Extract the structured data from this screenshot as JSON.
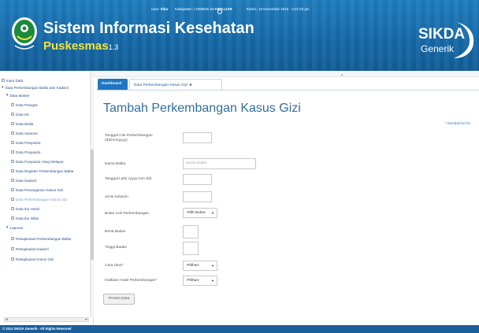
{
  "header": {
    "status": {
      "user_label": "User:",
      "user_name": "Ildar",
      "kabupaten": "Kabupaten: LOMBOK BARAT",
      "logout": "KELUAR",
      "datetime": "Kamis, 19 November 2015 - 2:21:53 pm"
    },
    "title_line1": "Sistem Informasi Kesehatan",
    "title_line2": "Puskesmas",
    "version": "1.3",
    "brand_line1": "SIKDA",
    "brand_line2": "Generik"
  },
  "sidebar": {
    "items": [
      {
        "label": "Input Data",
        "icon": "folder-icon"
      },
      {
        "label": "Data Perkembangan Balita dan Kadarzi",
        "icon": "expand-icon"
      },
      {
        "label": "Data Master",
        "icon": "expand-icon"
      },
      {
        "label": "Data Petugas",
        "icon": "page-icon"
      },
      {
        "label": "Data KK",
        "icon": "page-icon"
      },
      {
        "label": "Data Balita",
        "icon": "page-icon"
      },
      {
        "label": "Data Sasaran",
        "icon": "page-icon"
      },
      {
        "label": "Data Posyandu",
        "icon": "page-icon"
      },
      {
        "label": "Data Posyandu",
        "icon": "page-icon"
      },
      {
        "label": "Data Posyandu Yang Melapor",
        "icon": "page-icon"
      },
      {
        "label": "Data Register Perkembangan Balita",
        "icon": "page-icon"
      },
      {
        "label": "Data Kadarzi",
        "icon": "page-icon"
      },
      {
        "label": "Data Penanganan Kasus Gizi",
        "icon": "page-icon"
      },
      {
        "label": "Data Perkembangan Kasus Gizi",
        "icon": "page-icon"
      },
      {
        "label": "Data Ibu Hamil",
        "icon": "page-icon"
      },
      {
        "label": "Data Ibu Nifas",
        "icon": "page-icon"
      },
      {
        "label": "Laporan",
        "icon": "expand-icon"
      },
      {
        "label": "Rekapitulasi Perkembangan Balita",
        "icon": "page-icon"
      },
      {
        "label": "Rekapitulasi Kadarzi",
        "icon": "page-icon"
      },
      {
        "label": "Rekapitulasi Kasus Gizi",
        "icon": "page-icon"
      }
    ]
  },
  "tabs": {
    "dashboard": "Dashboard",
    "current": "Data Perkembangan Kasus Gizi",
    "close_icon": "close-icon"
  },
  "main": {
    "page_title": "Tambah Perkembangan Kasus Gizi",
    "back_link": "* kembali ke list",
    "form": {
      "tanggal_cek_label": "Tanggal Cek Perkembangan (dd/mm/yyyy)",
      "nama_balita_label": "Nama Balita",
      "nama_balita_placeholder": "Nama Balita",
      "tanggal_lahir_label": "Tanggal Lahir (yyyy-mm-dd)",
      "jenis_kelamin_label": "Jenis Kelamin",
      "bulan_cek_label": "Bulan Cek Perkembangan",
      "bulan_cek_value": "-Pilih Bulan-",
      "berat_badan_label": "Berat Badan",
      "tinggi_badan_label": "Tinggi Badan",
      "cara_ukur_label": "Cara Ukur*",
      "cara_ukur_value": "-Pilihan-",
      "indikator_label": "Indikator Hasil Perkembangan*",
      "indikator_value": "-Pilihan-",
      "submit_label": "Proses Data"
    }
  },
  "footer": {
    "text": "© 2014 SIKDA Generik - All Rights Reserved"
  },
  "colors": {
    "header_blue": "#1669a8",
    "title_yellow": "#f2e43c",
    "tab_blue": "#1f76c2",
    "page_title": "#326e9d",
    "footer_blue": "#1a5e9c"
  }
}
